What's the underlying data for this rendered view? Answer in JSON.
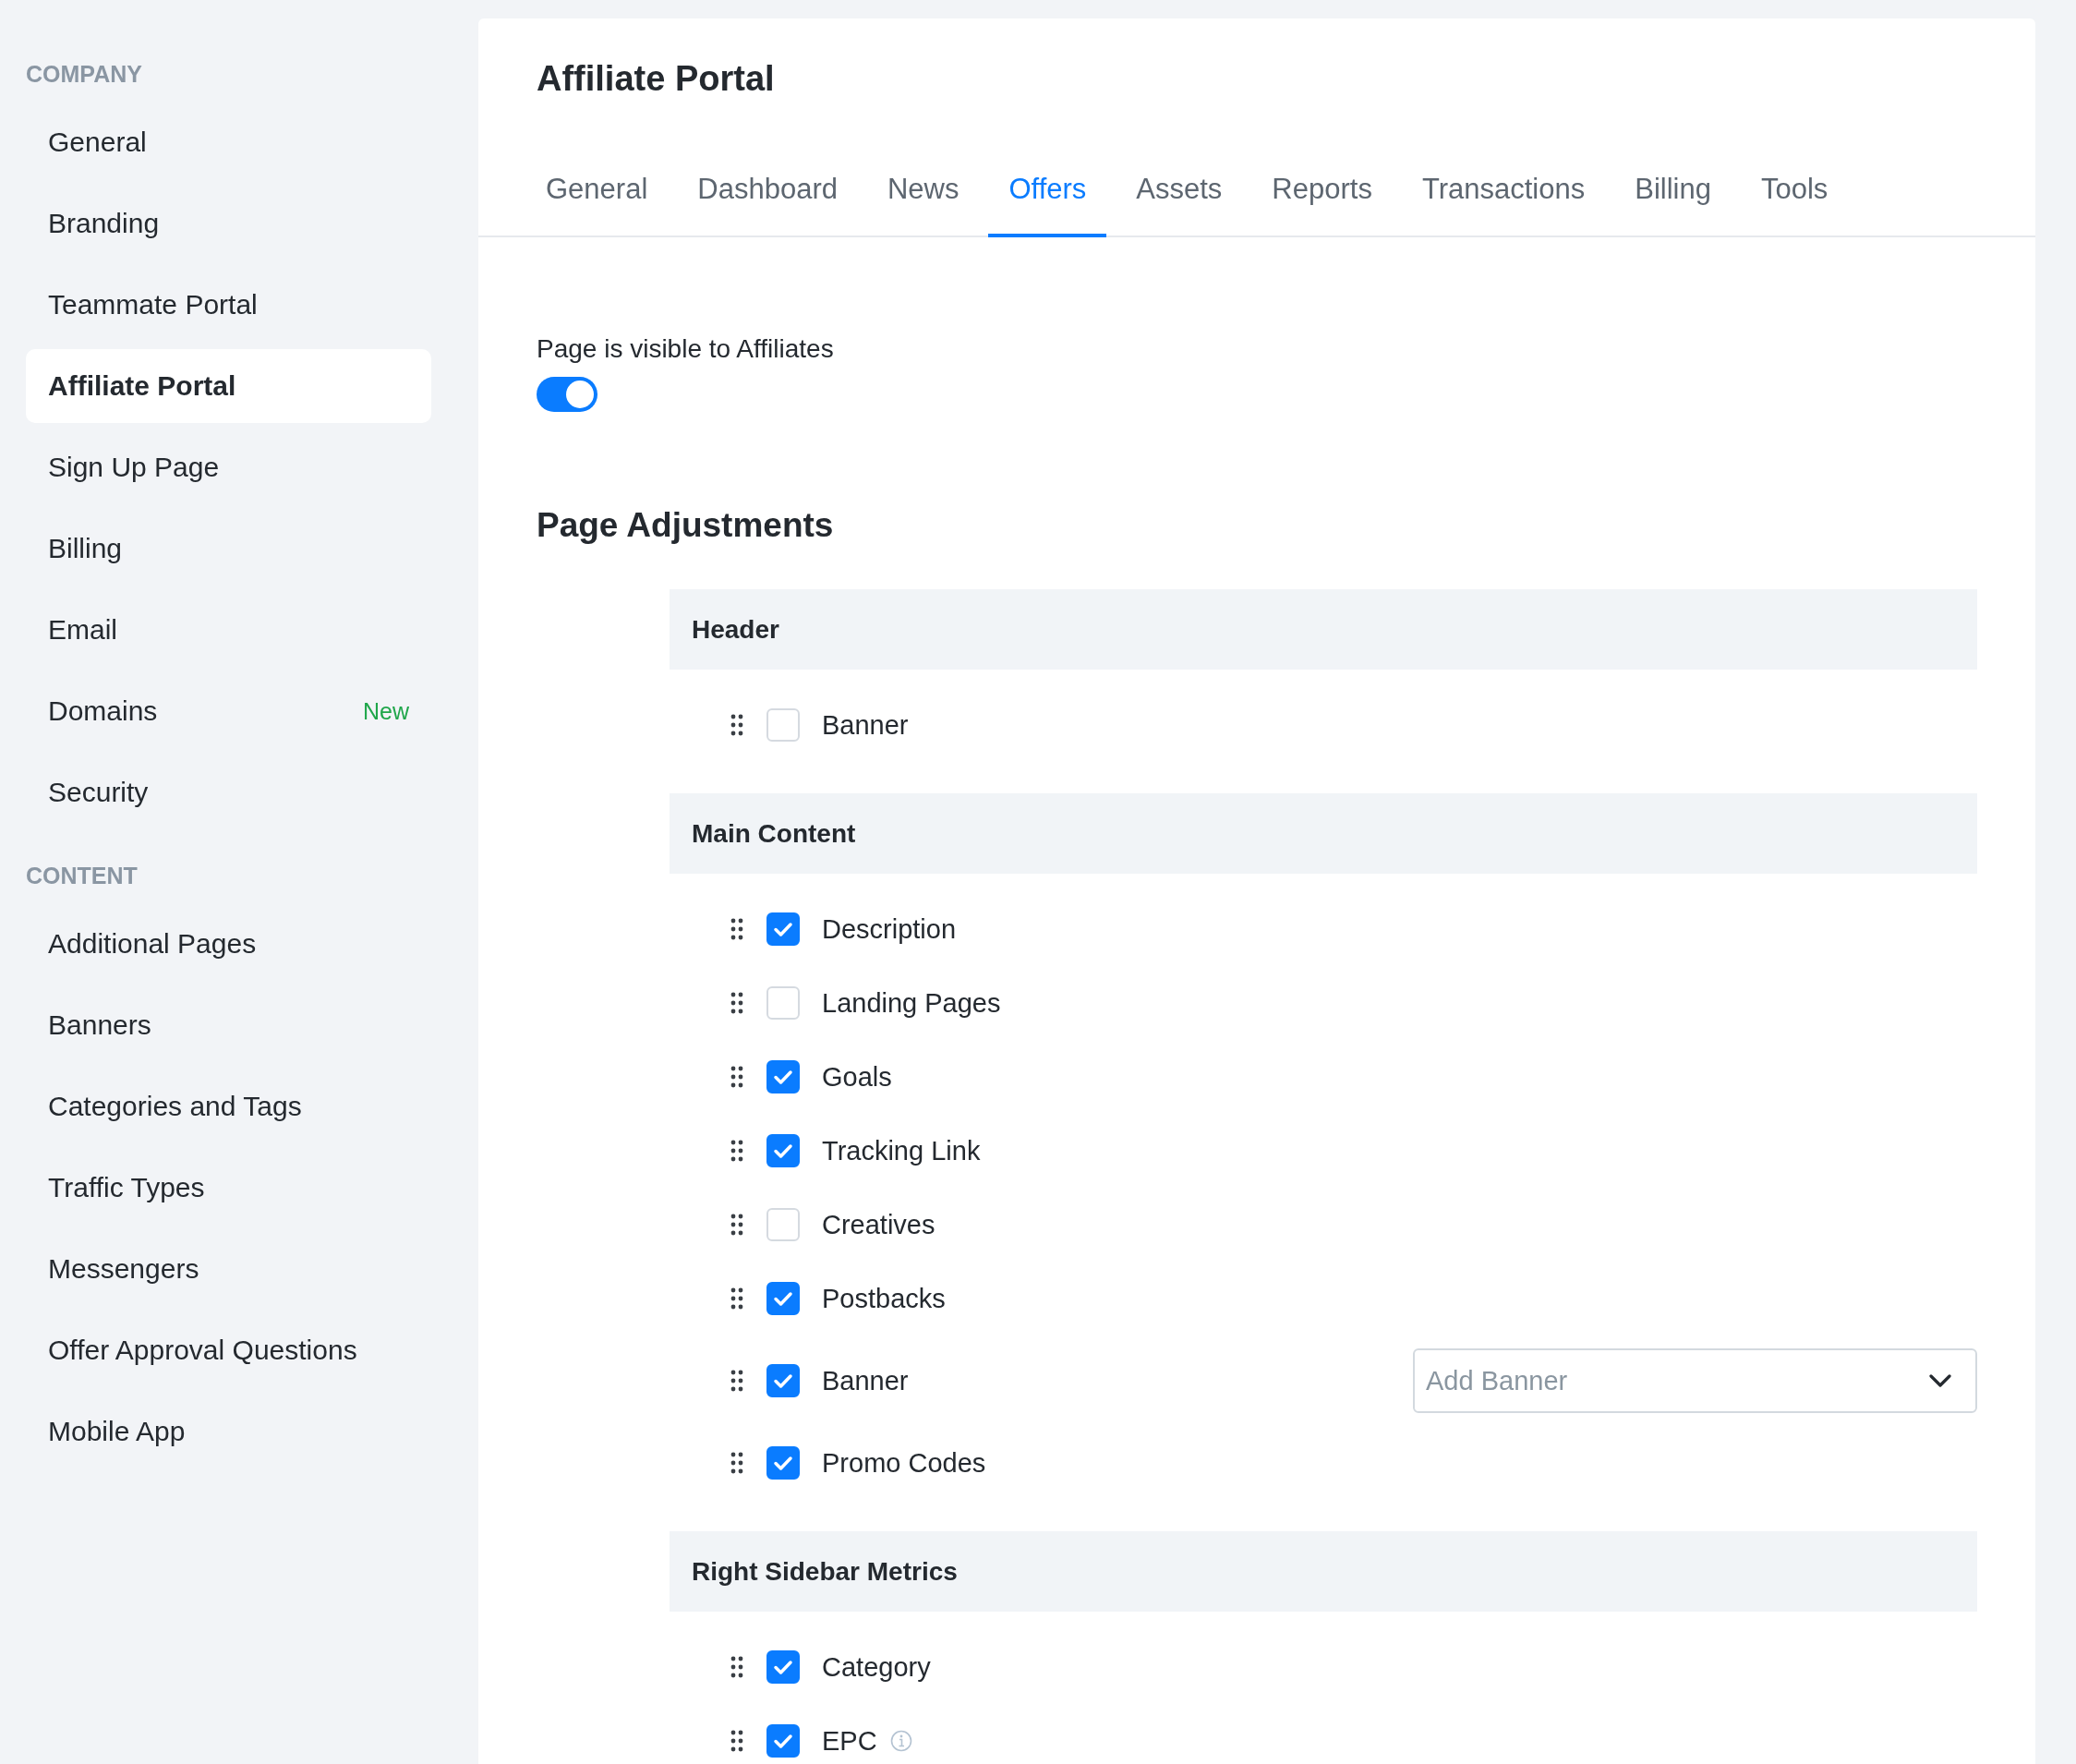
{
  "sidebar": {
    "sections": [
      {
        "heading": "COMPANY",
        "items": [
          {
            "label": "General",
            "selected": false
          },
          {
            "label": "Branding",
            "selected": false
          },
          {
            "label": "Teammate Portal",
            "selected": false
          },
          {
            "label": "Affiliate Portal",
            "selected": true
          },
          {
            "label": "Sign Up Page",
            "selected": false
          },
          {
            "label": "Billing",
            "selected": false
          },
          {
            "label": "Email",
            "selected": false
          },
          {
            "label": "Domains",
            "selected": false,
            "badge": "New"
          },
          {
            "label": "Security",
            "selected": false
          }
        ]
      },
      {
        "heading": "CONTENT",
        "items": [
          {
            "label": "Additional Pages",
            "selected": false
          },
          {
            "label": "Banners",
            "selected": false
          },
          {
            "label": "Categories and Tags",
            "selected": false
          },
          {
            "label": "Traffic Types",
            "selected": false
          },
          {
            "label": "Messengers",
            "selected": false
          },
          {
            "label": "Offer Approval Questions",
            "selected": false
          },
          {
            "label": "Mobile App",
            "selected": false
          }
        ]
      }
    ]
  },
  "main": {
    "title": "Affiliate Portal",
    "tabs": [
      {
        "label": "General",
        "selected": false
      },
      {
        "label": "Dashboard",
        "selected": false
      },
      {
        "label": "News",
        "selected": false
      },
      {
        "label": "Offers",
        "selected": true
      },
      {
        "label": "Assets",
        "selected": false
      },
      {
        "label": "Reports",
        "selected": false
      },
      {
        "label": "Transactions",
        "selected": false
      },
      {
        "label": "Billing",
        "selected": false
      },
      {
        "label": "Tools",
        "selected": false
      }
    ],
    "visibility": {
      "label": "Page is visible to Affiliates",
      "on": true
    },
    "adjustments": {
      "title": "Page Adjustments",
      "groups": [
        {
          "title": "Header",
          "items": [
            {
              "kind": "plain",
              "label": "Banner",
              "checked": false
            }
          ]
        },
        {
          "title": "Main Content",
          "items": [
            {
              "kind": "plain",
              "label": "Description",
              "checked": true
            },
            {
              "kind": "plain",
              "label": "Landing Pages",
              "checked": false
            },
            {
              "kind": "plain",
              "label": "Goals",
              "checked": true
            },
            {
              "kind": "plain",
              "label": "Tracking Link",
              "checked": true
            },
            {
              "kind": "plain",
              "label": "Creatives",
              "checked": false
            },
            {
              "kind": "plain",
              "label": "Postbacks",
              "checked": true
            },
            {
              "kind": "select",
              "label": "Banner",
              "checked": true,
              "placeholder": "Add Banner"
            },
            {
              "kind": "plain",
              "label": "Promo Codes",
              "checked": true
            }
          ]
        },
        {
          "title": "Right Sidebar Metrics",
          "items": [
            {
              "kind": "plain",
              "label": "Category",
              "checked": true
            },
            {
              "kind": "info",
              "label": "EPC",
              "checked": true
            }
          ]
        }
      ]
    }
  }
}
